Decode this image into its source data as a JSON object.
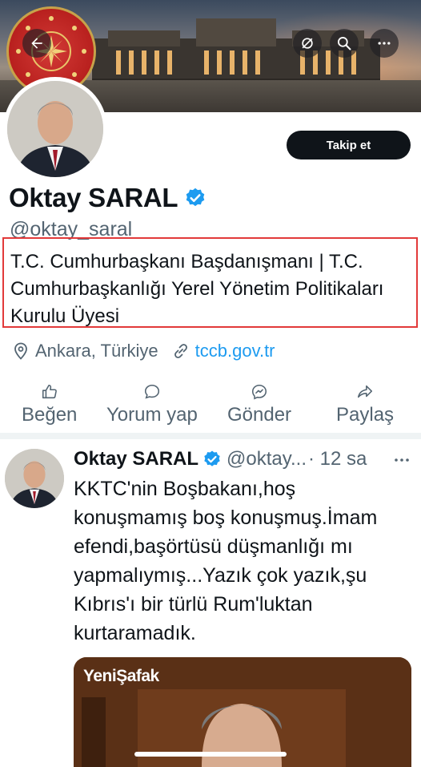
{
  "header": {
    "follow_label": "Takip et"
  },
  "profile": {
    "name": "Oktay SARAL",
    "handle": "@oktay_saral",
    "bio": "T.C. Cumhurbaşkanı Başdanışmanı | T.C. Cumhurbaşkanlığı Yerel Yönetim Politikaları Kurulu Üyesi",
    "location": "Ankara, Türkiye",
    "website": "tccb.gov.tr"
  },
  "actions": {
    "like": "Beğen",
    "reply": "Yorum yap",
    "send": "Gönder",
    "share": "Paylaş"
  },
  "tweet": {
    "name": "Oktay SARAL",
    "handle": "@oktay...",
    "time": "· 12 sa",
    "text": "KKTC'nin Boşbakanı,hoş konuşmamış boş konuşmuş.İmam efendi,başörtüsü düşmanlığı mı yapmalıymış...Yazık çok yazık,şu Kıbrıs'ı bir türlü Rum'luktan kurtaramadık.",
    "media_logo": "YeniŞafak"
  },
  "icons": {
    "back": "arrow-left-icon",
    "nosync": "bell-off-icon",
    "search": "search-icon",
    "more": "more-icon",
    "verified": "verified-badge-icon",
    "location": "location-pin-icon",
    "link": "link-icon",
    "like": "thumbs-up-icon",
    "reply": "comment-icon",
    "send": "messenger-icon",
    "share": "share-icon"
  },
  "colors": {
    "accent": "#1d9bf0",
    "highlight_box": "#e23a3a",
    "follow_bg": "#0f1419"
  }
}
